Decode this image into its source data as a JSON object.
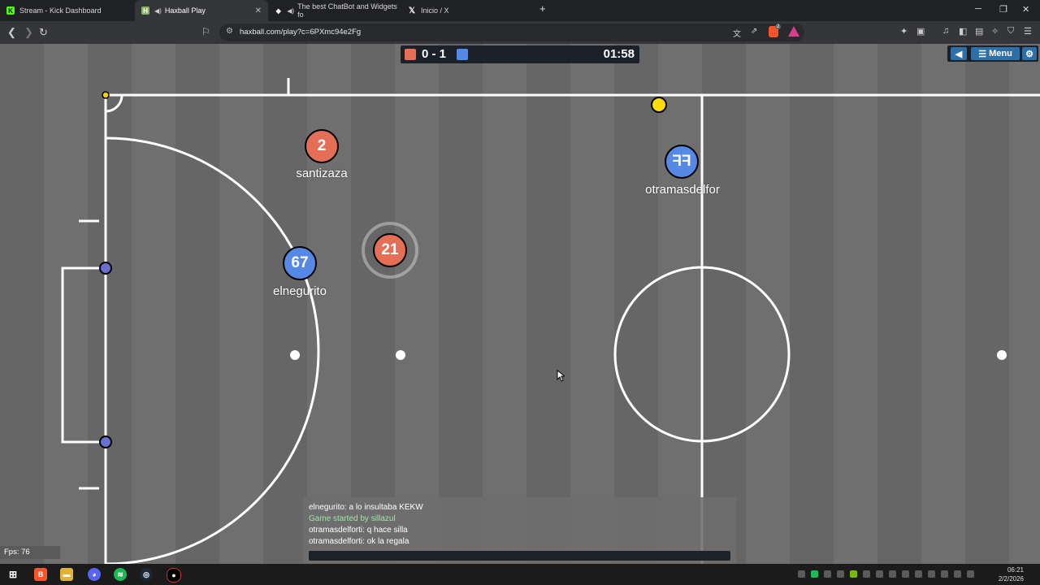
{
  "browser": {
    "tabs": [
      {
        "label": "Stream - Kick Dashboard",
        "favicon": "kick-icon",
        "color": "#53fc18",
        "speaker": false,
        "active": false
      },
      {
        "label": "Haxball Play",
        "favicon": "haxball-icon",
        "color": "#8ab36a",
        "speaker": true,
        "active": true
      },
      {
        "label": "The best ChatBot and Widgets fo",
        "favicon": "diamond-icon",
        "color": "#ffffff",
        "speaker": true,
        "active": false
      },
      {
        "label": "Inicio / X",
        "favicon": "x-icon",
        "color": "#ffffff",
        "speaker": false,
        "active": false
      }
    ],
    "new_tab": "+",
    "url": "haxball.com/play?c=6PXmc94e2Fg",
    "brave_badge": "2"
  },
  "game": {
    "score": "0 - 1",
    "timer": "01:58",
    "red_color": "#e56e56",
    "blue_color": "#5689e5",
    "menu_label": "Menu",
    "players": [
      {
        "team": "red",
        "avatar": "2",
        "name": "santizaza"
      },
      {
        "team": "red",
        "avatar": "21",
        "name": ""
      },
      {
        "team": "blue",
        "avatar": "67",
        "name": "elnegurito"
      },
      {
        "team": "blue",
        "avatar": "FF",
        "name": "otramasdelfor"
      }
    ],
    "ball_color": "#ffdd00",
    "fps": "Fps: 76"
  },
  "chat": {
    "lines": [
      {
        "text": "elnegurito: a lo insultaba KEKW",
        "color": "#ffffff"
      },
      {
        "text": "Game started by sillazul",
        "color": "#9fe3a8"
      },
      {
        "text": "otramasdelforti: q hace silla",
        "color": "#ffffff"
      },
      {
        "text": "otramasdelforti: ok la regala",
        "color": "#ffffff"
      }
    ]
  },
  "taskbar": {
    "time": "06:21",
    "date": "2/2/2026"
  }
}
